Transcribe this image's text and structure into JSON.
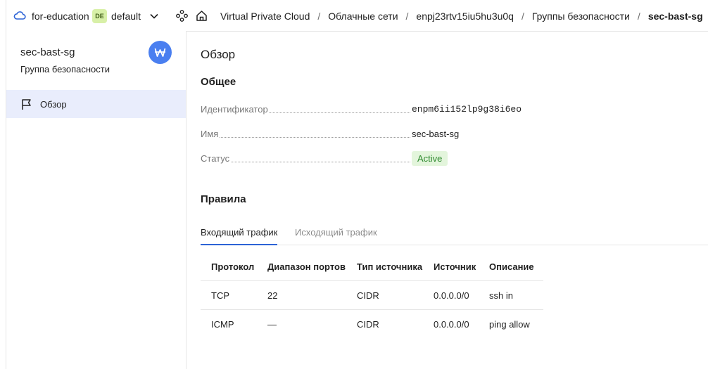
{
  "topbar": {
    "cloud_name": "for-education",
    "folder_badge": "DE",
    "folder_name": "default",
    "breadcrumbs": [
      "Virtual Private Cloud",
      "Облачные сети",
      "enpj23rtv15iu5hu3u0q",
      "Группы безопасности",
      "sec-bast-sg"
    ]
  },
  "sidebar": {
    "title": "sec-bast-sg",
    "subtitle": "Группа безопасности",
    "nav": [
      {
        "label": "Обзор",
        "icon": "flag-icon",
        "active": true
      }
    ]
  },
  "main": {
    "page_title": "Обзор",
    "general_heading": "Общее",
    "fields": [
      {
        "key": "Идентификатор",
        "value": "enpm6ii152lp9g38i6eo"
      },
      {
        "key": "Имя",
        "value": "sec-bast-sg"
      },
      {
        "key": "Статус",
        "value": "Active"
      }
    ],
    "rules_heading": "Правила",
    "tabs": [
      {
        "label": "Входящий трафик",
        "active": true
      },
      {
        "label": "Исходящий трафик",
        "active": false
      }
    ],
    "table": {
      "headers": [
        "Протокол",
        "Диапазон портов",
        "Тип источника",
        "Источник",
        "Описание"
      ],
      "rows": [
        [
          "TCP",
          "22",
          "CIDR",
          "0.0.0.0/0",
          "ssh in"
        ],
        [
          "ICMP",
          "—",
          "CIDR",
          "0.0.0.0/0",
          "ping allow"
        ]
      ]
    }
  },
  "colors": {
    "accent": "#2c63d6",
    "logo": "#4a7ff0",
    "nav_active_bg": "#e9edfc",
    "status_bg": "#e3f5dc",
    "status_text": "#2f8a2f"
  }
}
